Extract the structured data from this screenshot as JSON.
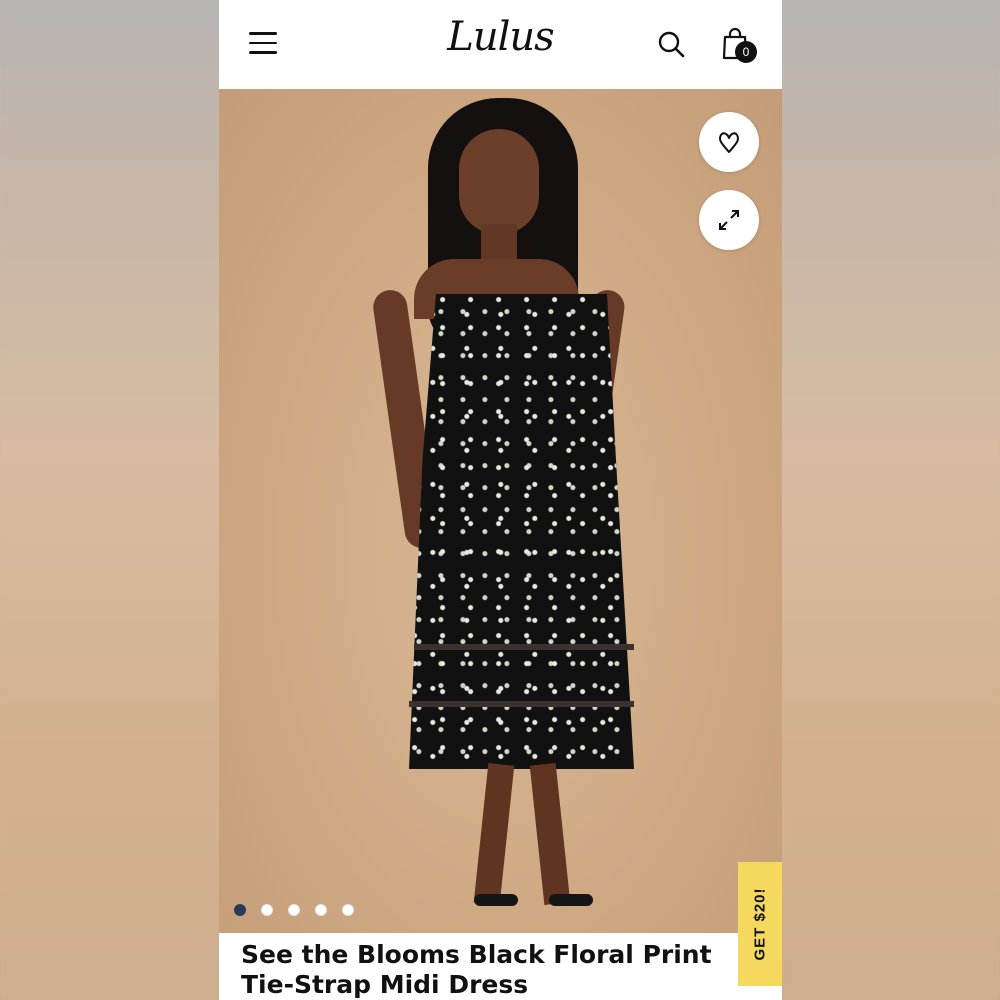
{
  "header": {
    "logo_text": "Lulus",
    "cart_count": "0",
    "menu_icon": "hamburger-menu-icon",
    "search_icon": "search-icon",
    "cart_icon": "shopping-bag-icon"
  },
  "product_image": {
    "favorite_icon": "heart-icon",
    "expand_icon": "expand-arrows-icon",
    "carousel_total": 5,
    "carousel_active": 1
  },
  "promo": {
    "label": "GET $20!",
    "color": "#f5d85e"
  },
  "product": {
    "title": "See the Blooms Black Floral Print Tie-Strap Midi Dress"
  }
}
